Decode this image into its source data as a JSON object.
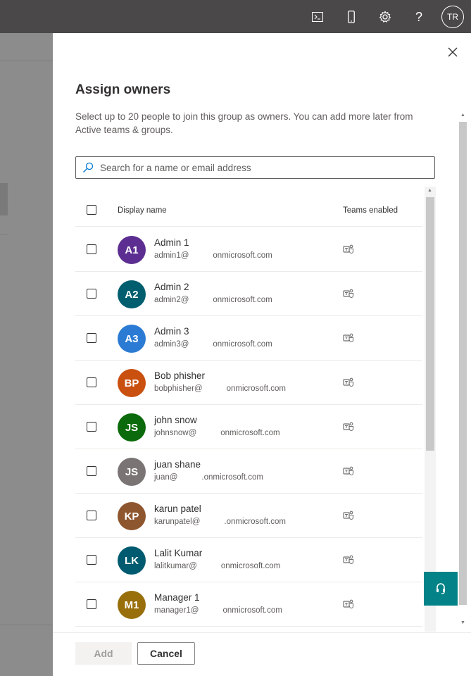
{
  "header": {
    "icons": [
      "terminal-icon",
      "mobile-icon",
      "gear-icon",
      "help-icon"
    ],
    "avatar_initials": "TR",
    "bg_color": "#4a4848"
  },
  "panel": {
    "title": "Assign owners",
    "description": "Select up to 20 people to join this group as owners. You can add more later from Active teams & groups.",
    "search_placeholder": "Search for a name or email address",
    "columns": {
      "display_name": "Display name",
      "teams_enabled": "Teams enabled"
    },
    "people": [
      {
        "initials": "A1",
        "name": "Admin 1",
        "email_user": "admin1@",
        "email_domain": "onmicrosoft.com",
        "color": "#5c2e91",
        "teams_enabled": true
      },
      {
        "initials": "A2",
        "name": "Admin 2",
        "email_user": "admin2@",
        "email_domain": "onmicrosoft.com",
        "color": "#005e6e",
        "teams_enabled": true
      },
      {
        "initials": "A3",
        "name": "Admin 3",
        "email_user": "admin3@",
        "email_domain": "onmicrosoft.com",
        "color": "#2b7bd4",
        "teams_enabled": true
      },
      {
        "initials": "BP",
        "name": "Bob phisher",
        "email_user": "bobphisher@",
        "email_domain": "onmicrosoft.com",
        "color": "#ca5010",
        "teams_enabled": true
      },
      {
        "initials": "JS",
        "name": "john snow",
        "email_user": "johnsnow@",
        "email_domain": "onmicrosoft.com",
        "color": "#0b6a0b",
        "teams_enabled": true
      },
      {
        "initials": "JS",
        "name": "juan shane",
        "email_user": "juan@",
        "email_domain": ".onmicrosoft.com",
        "color": "#7a7574",
        "teams_enabled": true
      },
      {
        "initials": "KP",
        "name": "karun patel",
        "email_user": "karunpatel@",
        "email_domain": ".onmicrosoft.com",
        "color": "#8e562e",
        "teams_enabled": true
      },
      {
        "initials": "LK",
        "name": "Lalit Kumar",
        "email_user": "lalitkumar@",
        "email_domain": "onmicrosoft.com",
        "color": "#005b70",
        "teams_enabled": true
      },
      {
        "initials": "M1",
        "name": "Manager 1",
        "email_user": "manager1@",
        "email_domain": "onmicrosoft.com",
        "color": "#986f0b",
        "teams_enabled": true
      }
    ],
    "buttons": {
      "add": "Add",
      "cancel": "Cancel"
    },
    "support_color": "#038387"
  }
}
